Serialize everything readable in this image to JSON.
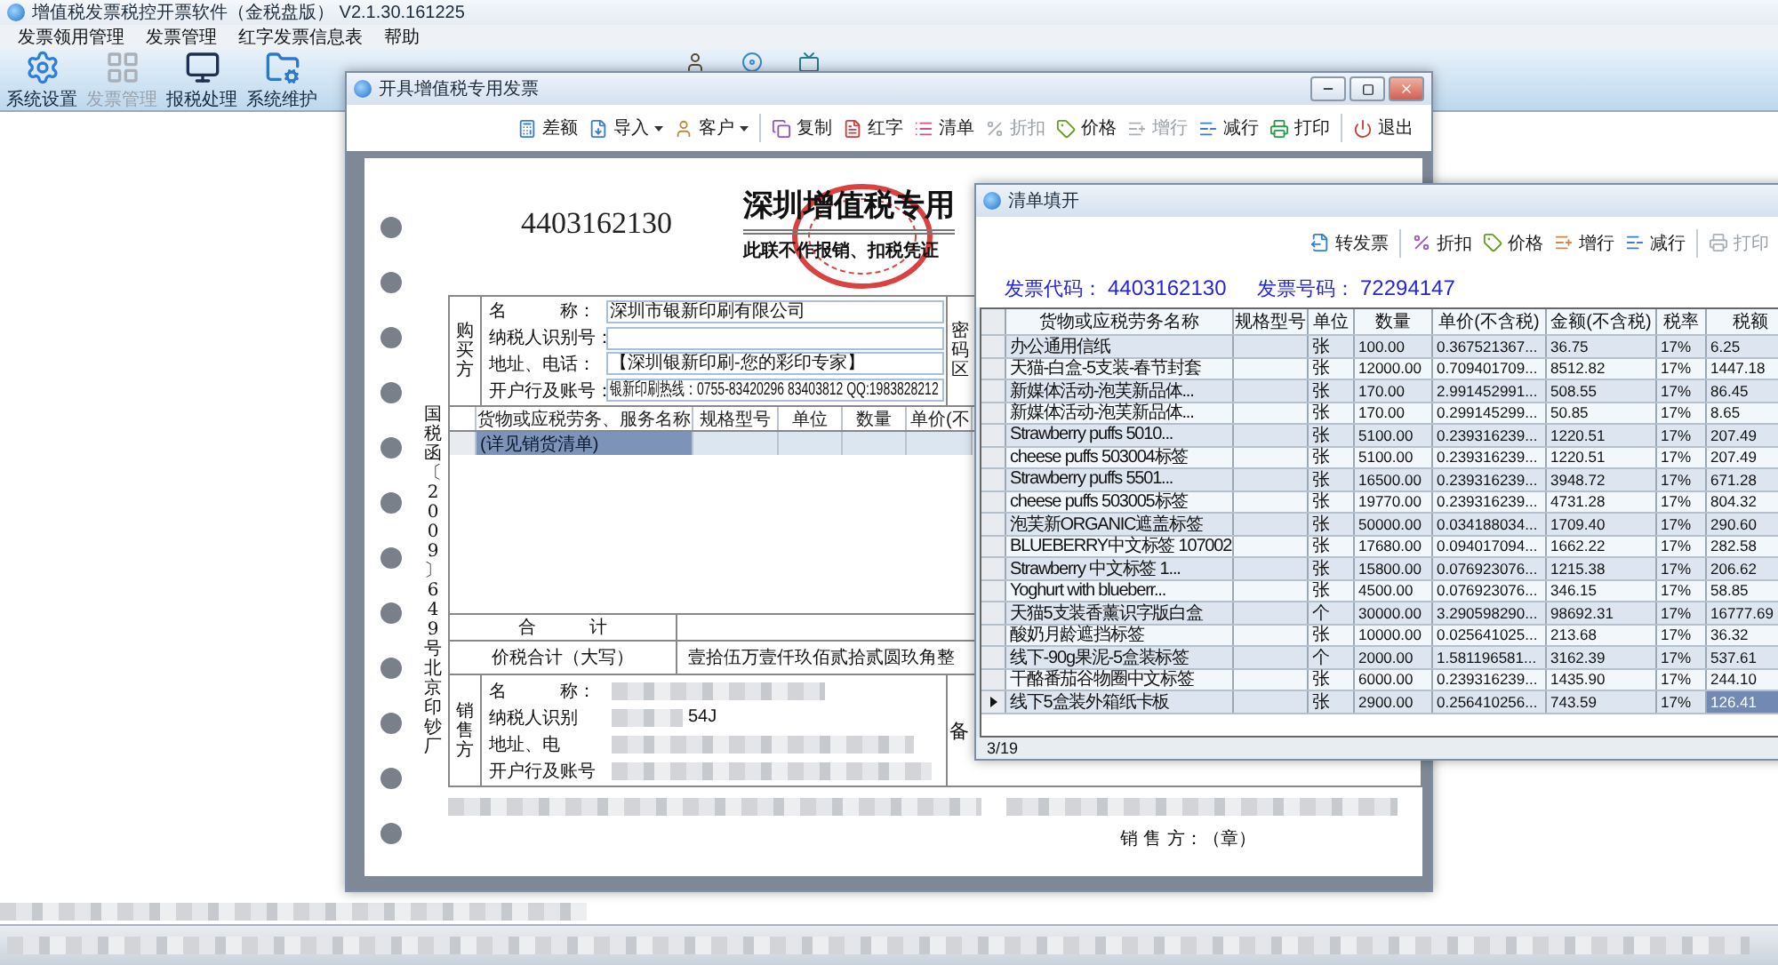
{
  "app": {
    "title": "增值税发票税控开票软件（金税盘版） V2.1.30.161225",
    "menu": [
      "发票领用管理",
      "发票管理",
      "红字发票信息表",
      "帮助"
    ],
    "toolbar": [
      {
        "label": "系统设置",
        "disabled": false
      },
      {
        "label": "发票管理",
        "disabled": true
      },
      {
        "label": "报税处理",
        "disabled": false
      },
      {
        "label": "系统维护",
        "disabled": false
      }
    ]
  },
  "invoice_window": {
    "title": "开具增值税专用发票",
    "toolbar": [
      {
        "label": "差额",
        "dropdown": false,
        "disabled": false
      },
      {
        "label": "导入",
        "dropdown": true,
        "disabled": false
      },
      {
        "label": "客户",
        "dropdown": true,
        "disabled": false
      },
      {
        "label": "复制",
        "dropdown": false,
        "disabled": false
      },
      {
        "label": "红字",
        "dropdown": false,
        "disabled": false
      },
      {
        "label": "清单",
        "dropdown": false,
        "disabled": false
      },
      {
        "label": "折扣",
        "dropdown": false,
        "disabled": true
      },
      {
        "label": "价格",
        "dropdown": false,
        "disabled": false
      },
      {
        "label": "增行",
        "dropdown": false,
        "disabled": true
      },
      {
        "label": "减行",
        "dropdown": false,
        "disabled": false
      },
      {
        "label": "打印",
        "dropdown": false,
        "disabled": false
      },
      {
        "label": "退出",
        "dropdown": false,
        "disabled": false
      }
    ],
    "invoice": {
      "code": "4403162130",
      "title": "深圳增值税专用",
      "subtitle": "此联不作报销、扣税凭证",
      "side_text": "国税函〔2009〕649号北京印钞厂",
      "buyer": {
        "side_label": "购买方",
        "password_label": "密码区",
        "fields": [
          {
            "label": "名　　　称：",
            "value": "深圳市银新印刷有限公司"
          },
          {
            "label": "纳税人识别号："
          },
          {
            "label": "地址、电话：",
            "value": "【深圳银新印刷-您的彩印专家】"
          },
          {
            "label": "开户行及账号：",
            "value": "银新印刷热线：0755-83420296 83403812 QQ:1983828212"
          }
        ]
      },
      "items": {
        "columns": [
          "货物或应税劳务、服务名称",
          "规格型号",
          "单位",
          "数量",
          "单价(不"
        ],
        "rows": [
          {
            "name": "(详见销货清单)",
            "selected": true
          }
        ]
      },
      "total_label": "合　　　计",
      "caps_label": "价税合计（大写）",
      "caps_value": "壹拾伍万壹仟玖佰贰拾贰圆玖角整",
      "seller": {
        "side_label": "销售方",
        "remarks_label": "备",
        "fields": [
          {
            "label": "名　　　称："
          },
          {
            "label": "纳税人识别",
            "value": "54J"
          },
          {
            "label": "地址、电"
          },
          {
            "label": "开户行及账号"
          }
        ]
      },
      "stamp_line": "销 售 方：（章）"
    }
  },
  "list_window": {
    "title": "清单填开",
    "toolbar": [
      {
        "label": "转发票",
        "disabled": false
      },
      {
        "label": "折扣",
        "disabled": false
      },
      {
        "label": "价格",
        "disabled": false
      },
      {
        "label": "增行",
        "disabled": false
      },
      {
        "label": "减行",
        "disabled": false
      },
      {
        "label": "打印",
        "disabled": true
      }
    ],
    "code_label": "发票代码：",
    "code": "4403162130",
    "number_label": "发票号码：",
    "number": "72294147",
    "columns": [
      "货物或应税劳务名称",
      "规格型号",
      "单位",
      "数量",
      "单价(不含税)",
      "金额(不含税)",
      "税率",
      "税额"
    ],
    "rows": [
      {
        "name": "办公通用信纸",
        "unit": "张",
        "quantity": "100.00",
        "price": "0.367521367...",
        "amount": "36.75",
        "rate": "17%",
        "tax": "6.25",
        "selected": false
      },
      {
        "name": "天猫-白盒-5支装-春节封套",
        "unit": "张",
        "quantity": "12000.00",
        "price": "0.709401709...",
        "amount": "8512.82",
        "rate": "17%",
        "tax": "1447.18",
        "selected": false
      },
      {
        "name": "新媒体活动-泡芙新品体...",
        "unit": "张",
        "quantity": "170.00",
        "price": "2.991452991...",
        "amount": "508.55",
        "rate": "17%",
        "tax": "86.45",
        "selected": false
      },
      {
        "name": "新媒体活动-泡芙新品体...",
        "unit": "张",
        "quantity": "170.00",
        "price": "0.299145299...",
        "amount": "50.85",
        "rate": "17%",
        "tax": "8.65",
        "selected": false
      },
      {
        "name": "Strawberry puffs 5010...",
        "unit": "张",
        "quantity": "5100.00",
        "price": "0.239316239...",
        "amount": "1220.51",
        "rate": "17%",
        "tax": "207.49",
        "selected": false
      },
      {
        "name": "cheese puffs 503004标签",
        "unit": "张",
        "quantity": "5100.00",
        "price": "0.239316239...",
        "amount": "1220.51",
        "rate": "17%",
        "tax": "207.49",
        "selected": false
      },
      {
        "name": "Strawberry puffs 5501...",
        "unit": "张",
        "quantity": "16500.00",
        "price": "0.239316239...",
        "amount": "3948.72",
        "rate": "17%",
        "tax": "671.28",
        "selected": false
      },
      {
        "name": "cheese puffs 503005标签",
        "unit": "张",
        "quantity": "19770.00",
        "price": "0.239316239...",
        "amount": "4731.28",
        "rate": "17%",
        "tax": "804.32",
        "selected": false
      },
      {
        "name": "泡芙新ORGANIC遮盖标签",
        "unit": "张",
        "quantity": "50000.00",
        "price": "0.034188034...",
        "amount": "1709.40",
        "rate": "17%",
        "tax": "290.60",
        "selected": false
      },
      {
        "name": "BLUEBERRY中文标签 107002",
        "unit": "张",
        "quantity": "17680.00",
        "price": "0.094017094...",
        "amount": "1662.22",
        "rate": "17%",
        "tax": "282.58",
        "selected": false
      },
      {
        "name": "Strawberry 中文标签 1...",
        "unit": "张",
        "quantity": "15800.00",
        "price": "0.076923076...",
        "amount": "1215.38",
        "rate": "17%",
        "tax": "206.62",
        "selected": false
      },
      {
        "name": "Yoghurt with blueberr...",
        "unit": "张",
        "quantity": "4500.00",
        "price": "0.076923076...",
        "amount": "346.15",
        "rate": "17%",
        "tax": "58.85",
        "selected": false
      },
      {
        "name": "天猫5支装香薰识字版白盒",
        "unit": "个",
        "quantity": "30000.00",
        "price": "3.290598290...",
        "amount": "98692.31",
        "rate": "17%",
        "tax": "16777.69",
        "selected": false
      },
      {
        "name": "酸奶月龄遮挡标签",
        "unit": "张",
        "quantity": "10000.00",
        "price": "0.025641025...",
        "amount": "213.68",
        "rate": "17%",
        "tax": "36.32",
        "selected": false
      },
      {
        "name": "线下-90g果泥-5盒装标签",
        "unit": "个",
        "quantity": "2000.00",
        "price": "1.581196581...",
        "amount": "3162.39",
        "rate": "17%",
        "tax": "537.61",
        "selected": false
      },
      {
        "name": "干酪番茄谷物圈中文标签",
        "unit": "张",
        "quantity": "6000.00",
        "price": "0.239316239...",
        "amount": "1435.90",
        "rate": "17%",
        "tax": "244.10",
        "selected": false
      },
      {
        "name": "线下5盒装外箱纸卡板",
        "unit": "张",
        "quantity": "2900.00",
        "price": "0.256410256...",
        "amount": "743.59",
        "rate": "17%",
        "tax": "126.41",
        "selected": true
      }
    ],
    "page": "3/19"
  }
}
